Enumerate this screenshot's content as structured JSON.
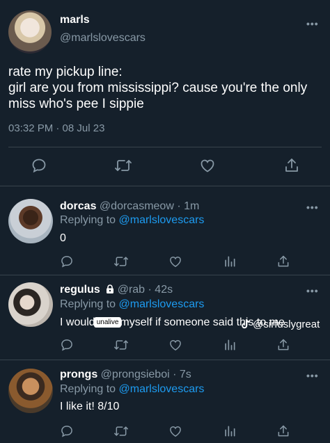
{
  "main_tweet": {
    "name": "marls",
    "handle": "@marlslovescars",
    "text": "rate my pickup line:\ngirl are you from mississippi? cause you're the only miss who's pee I sippie",
    "timestamp": "03:32 PM · 08 Jul 23"
  },
  "replies": [
    {
      "name": "dorcas",
      "meta": "@dorcasmeow · 1m",
      "replying_prefix": "Replying to",
      "replying_to": "@marlslovescars",
      "text": "0",
      "locked": false
    },
    {
      "name": "regulus",
      "meta": "@rab · 42s",
      "replying_prefix": "Replying to",
      "replying_to": "@marlslovescars",
      "text_before": "I would",
      "censor": "unalive",
      "text_after": "myself if someone said this to me",
      "locked": true
    },
    {
      "name": "prongs",
      "meta": "@prongsieboi · 7s",
      "replying_prefix": "Replying to",
      "replying_to": "@marlslovescars",
      "text": "I like it! 8/10",
      "locked": false
    }
  ],
  "more_label": "•••",
  "watermark": "@sirfuslygreat",
  "icons": [
    "comment-icon",
    "retweet-icon",
    "like-icon",
    "analytics-icon",
    "share-icon",
    "lock-icon",
    "tiktok-icon"
  ],
  "colors": {
    "background": "#15202b",
    "secondary_text": "#8899a6",
    "link": "#1d9bf0",
    "divider": "#38444d"
  }
}
